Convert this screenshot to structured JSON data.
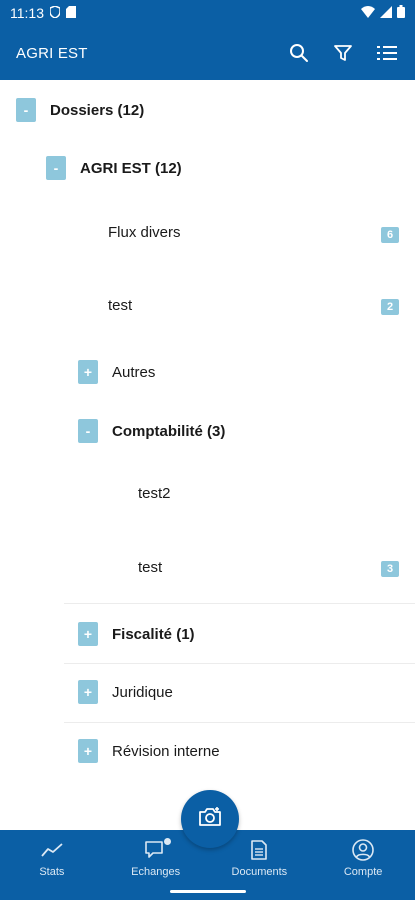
{
  "status": {
    "time": "11:13"
  },
  "app_bar": {
    "title": "AGRI EST",
    "icons": [
      "search-icon",
      "filter-icon",
      "list-sort-icon"
    ]
  },
  "tree": {
    "root": {
      "label": "Dossiers (12)",
      "toggle": "-"
    },
    "client": {
      "label": "AGRI EST (12)",
      "toggle": "-"
    },
    "flux": {
      "label": "Flux divers",
      "count": "6"
    },
    "test_a": {
      "label": "test",
      "count": "2"
    },
    "autres": {
      "label": "Autres",
      "toggle": "+"
    },
    "compta": {
      "label": "Comptabilité (3)",
      "toggle": "-"
    },
    "test2": {
      "label": "test2"
    },
    "test_b": {
      "label": "test",
      "count": "3"
    },
    "fiscalite": {
      "label": "Fiscalité (1)",
      "toggle": "+"
    },
    "juridique": {
      "label": "Juridique",
      "toggle": "+"
    },
    "revision": {
      "label": "Révision interne",
      "toggle": "+"
    }
  },
  "bottom_nav": {
    "stats": "Stats",
    "echanges": "Echanges",
    "documents": "Documents",
    "compte": "Compte"
  },
  "colors": {
    "primary": "#0b5fa5",
    "badge": "#8ec7dc"
  }
}
